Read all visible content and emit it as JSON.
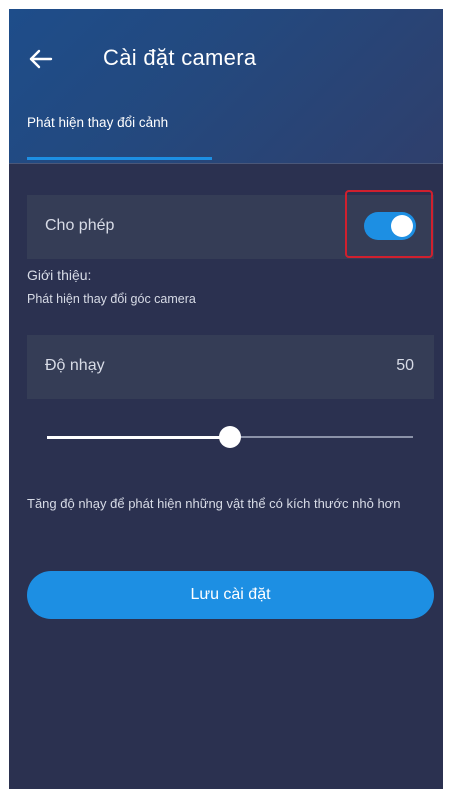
{
  "header": {
    "title": "Cài đặt camera",
    "back_icon": "arrow-left-icon"
  },
  "tabs": [
    {
      "label": "Phát hiện thay đổi cảnh",
      "active": true
    }
  ],
  "enable_row": {
    "label": "Cho phép",
    "toggle_on": true
  },
  "intro": {
    "title": "Giới thiệu:",
    "text": "Phát hiện thay đổi góc camera"
  },
  "sensitivity": {
    "label": "Độ nhạy",
    "value": "50",
    "level_fraction": 0.5
  },
  "hint": "Tăng độ nhạy để phát hiện những vật thể có kích thước nhỏ hơn",
  "save_button": {
    "label": "Lưu cài đặt"
  },
  "colors": {
    "accent": "#1d8fe3",
    "background": "#2b3150",
    "row_background": "#353d56",
    "highlight_border": "#d0202e"
  }
}
